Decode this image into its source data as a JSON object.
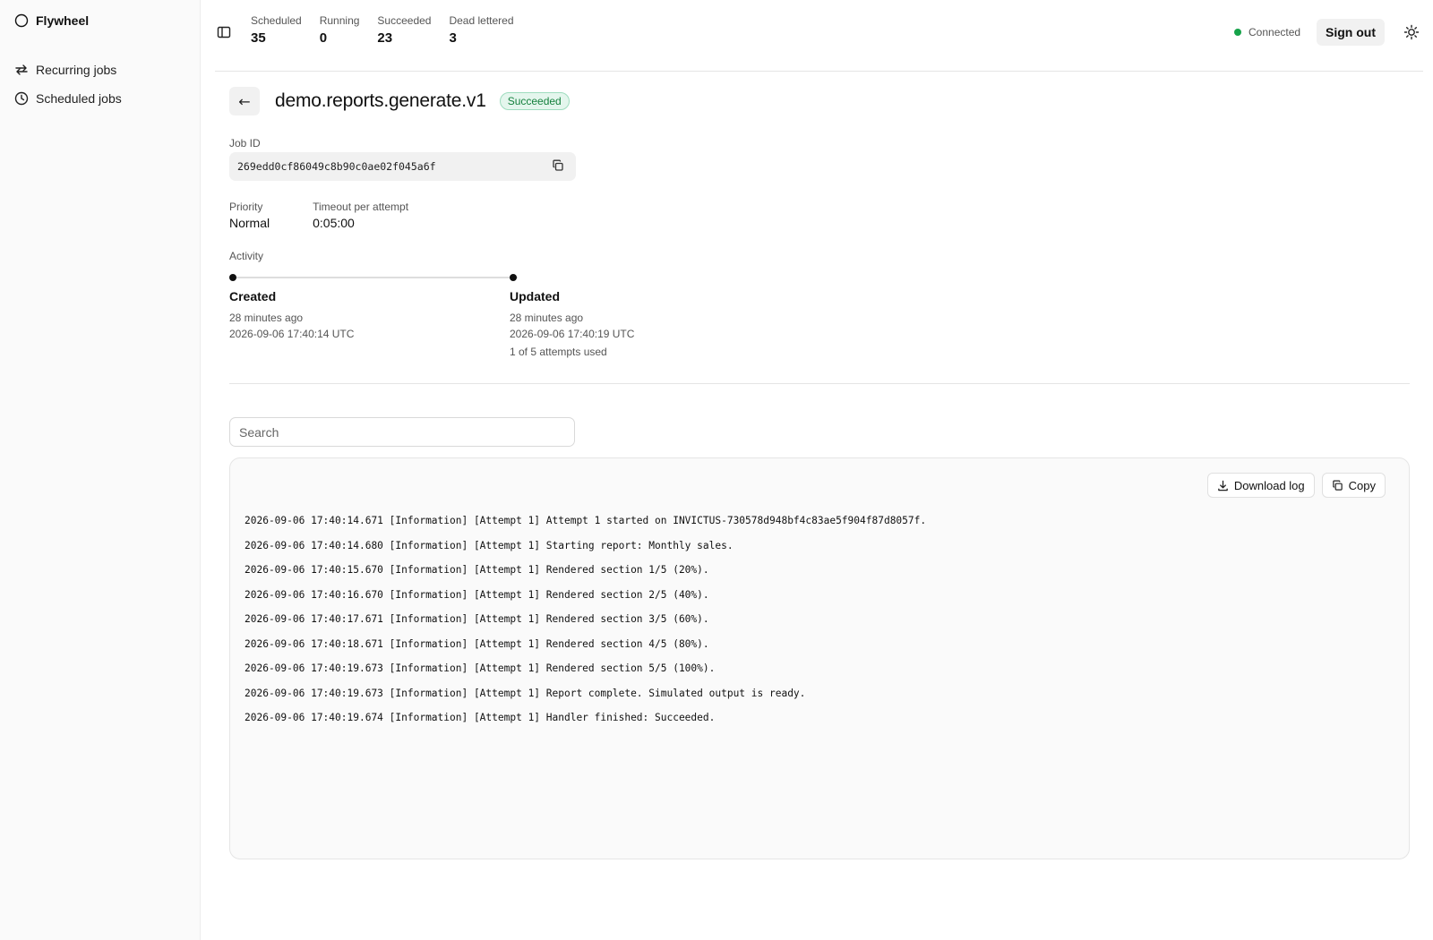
{
  "app": {
    "name": "Flywheel"
  },
  "sidebar": {
    "items": [
      {
        "label": "Recurring jobs",
        "icon": "repeat-icon"
      },
      {
        "label": "Scheduled jobs",
        "icon": "clock-icon"
      }
    ]
  },
  "header": {
    "stats": [
      {
        "label": "Scheduled",
        "value": "35"
      },
      {
        "label": "Running",
        "value": "0"
      },
      {
        "label": "Succeeded",
        "value": "23"
      },
      {
        "label": "Dead lettered",
        "value": "3"
      }
    ],
    "connection": {
      "label": "Connected",
      "color": "#16a34a"
    },
    "signout_label": "Sign out"
  },
  "job": {
    "back_label": "←",
    "title": "demo.reports.generate.v1",
    "status": "Succeeded",
    "id_label": "Job ID",
    "id": "269edd0cf86049c8b90c0ae02f045a6f",
    "priority_label": "Priority",
    "priority": "Normal",
    "timeout_label": "Timeout per attempt",
    "timeout": "0:05:00"
  },
  "activity": {
    "label": "Activity",
    "created": {
      "title": "Created",
      "relative": "28 minutes ago",
      "timestamp": "2026-09-06 17:40:14 UTC"
    },
    "updated": {
      "title": "Updated",
      "relative": "28 minutes ago",
      "timestamp": "2026-09-06 17:40:19 UTC",
      "attempts": "1 of 5 attempts used"
    }
  },
  "log": {
    "search_placeholder": "Search",
    "download_label": "Download log",
    "copy_label": "Copy",
    "lines": [
      "2026-09-06 17:40:14.671 [Information] [Attempt 1] Attempt 1 started on INVICTUS-730578d948bf4c83ae5f904f87d8057f.",
      "2026-09-06 17:40:14.680 [Information] [Attempt 1] Starting report: Monthly sales.",
      "2026-09-06 17:40:15.670 [Information] [Attempt 1] Rendered section 1/5 (20%).",
      "2026-09-06 17:40:16.670 [Information] [Attempt 1] Rendered section 2/5 (40%).",
      "2026-09-06 17:40:17.671 [Information] [Attempt 1] Rendered section 3/5 (60%).",
      "2026-09-06 17:40:18.671 [Information] [Attempt 1] Rendered section 4/5 (80%).",
      "2026-09-06 17:40:19.673 [Information] [Attempt 1] Rendered section 5/5 (100%).",
      "2026-09-06 17:40:19.673 [Information] [Attempt 1] Report complete. Simulated output is ready.",
      "2026-09-06 17:40:19.674 [Information] [Attempt 1] Handler finished: Succeeded."
    ]
  }
}
